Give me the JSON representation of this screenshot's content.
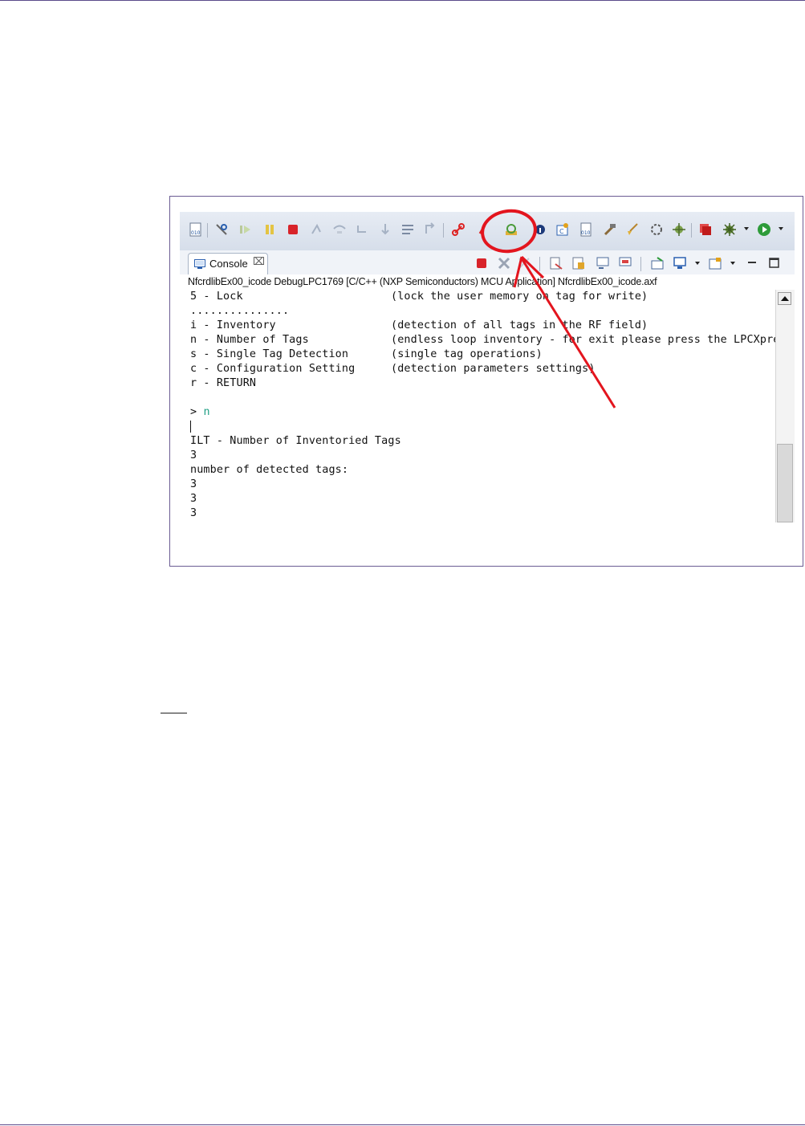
{
  "console": {
    "tab_label": "Console",
    "tab_close": "⌧",
    "launch_label": "NfcrdlibEx00_icode DebugLPC1769 [C/C++ (NXP Semiconductors) MCU Application] NfcrdlibEx00_icode.axf",
    "lines": [
      {
        "left": "5 - Lock",
        "right": "(lock the user memory on tag for write)"
      },
      {
        "left": "...............",
        "right": ""
      },
      {
        "left": "i - Inventory",
        "right": "(detection of all tags in the RF field)"
      },
      {
        "left": "n - Number of Tags",
        "right": "(endless loop inventory - for exit please press the LPCXpre"
      },
      {
        "left": "s - Single Tag Detection",
        "right": "(single tag operations)"
      },
      {
        "left": "c - Configuration Setting",
        "right": "(detection parameters settings)"
      },
      {
        "left": "r - RETURN",
        "right": ""
      },
      {
        "left": "",
        "right": ""
      },
      {
        "left": "> ",
        "input": "n",
        "right": ""
      },
      {
        "left": "",
        "right": ""
      },
      {
        "left": "ILT - Number of Inventoried Tags",
        "right": ""
      },
      {
        "left": "3",
        "right": ""
      },
      {
        "left": "number of detected tags:",
        "right": ""
      },
      {
        "left": "3",
        "right": ""
      },
      {
        "left": "3",
        "right": ""
      },
      {
        "left": "3",
        "right": ""
      }
    ]
  },
  "toolbar": {
    "icons": [
      "binary-file-icon",
      "disconnect-icon",
      "resume-icon",
      "suspend-icon",
      "terminate-icon",
      "step-into-icon",
      "step-over-icon",
      "step-return-icon",
      "drop-to-frame-icon",
      "use-step-filters-icon",
      "instruction-step-icon",
      "link-icon",
      "unlink-icon",
      "reset-target-icon",
      "info-icon",
      "cmsis-icon",
      "hex-file-icon",
      "build-icon",
      "clean-icon",
      "debug-settings-icon",
      "debug-icon",
      "stop-all-icon",
      "debug-config-icon",
      "run-icon"
    ],
    "console_icons": [
      "terminate-console-icon",
      "remove-launch-icon",
      "remove-all-launches-icon",
      "clear-console-icon",
      "scroll-lock-icon",
      "word-wrap-icon",
      "show-console-icon",
      "pin-console-icon",
      "display-console-icon",
      "open-console-icon",
      "minimize-icon",
      "maximize-icon"
    ],
    "highlight_color": "#e3151e"
  }
}
